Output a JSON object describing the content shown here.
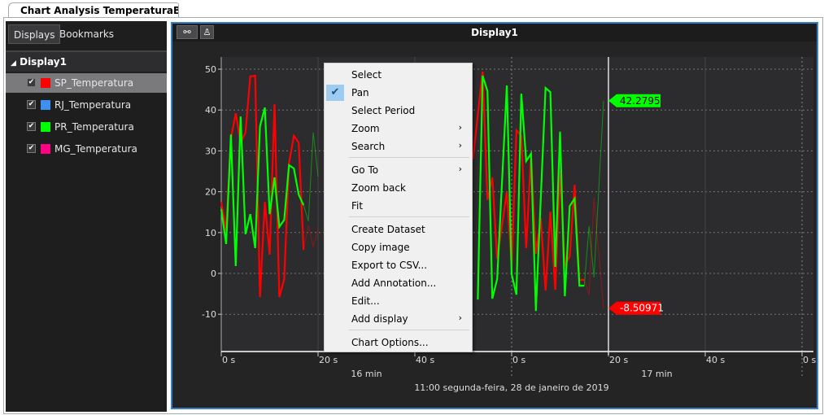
{
  "tab": {
    "title": "Chart Analysis TemperaturaBrasil*"
  },
  "sidebar": {
    "tabs": [
      "Displays",
      "Bookmarks"
    ],
    "group": "Display1",
    "items": [
      {
        "label": "SP_Temperatura",
        "color": "#ff0000",
        "checked": true,
        "selected": true
      },
      {
        "label": "RJ_Temperatura",
        "color": "#3d8ff0",
        "checked": true,
        "selected": false
      },
      {
        "label": "PR_Temperatura",
        "color": "#00ff00",
        "checked": true,
        "selected": false
      },
      {
        "label": "MG_Temperatura",
        "color": "#ff0080",
        "checked": true,
        "selected": false
      }
    ]
  },
  "display": {
    "title": "Display1",
    "toolbar": [
      "link-icon",
      "person-icon"
    ]
  },
  "context_menu": {
    "items": [
      "Select",
      "Pan",
      "Select Period",
      "Zoom",
      "Search",
      "Go To",
      "Zoom back",
      "Fit",
      "Create Dataset",
      "Copy image",
      "Export to CSV...",
      "Add Annotation...",
      "Edit...",
      "Add display",
      "Chart Options..."
    ],
    "checked": "Pan",
    "submenus": [
      "Zoom",
      "Search",
      "Go To",
      "Add display"
    ]
  },
  "chart_data": {
    "type": "line",
    "ylim": [
      -18,
      53
    ],
    "yticks": [
      "50",
      "40",
      "30",
      "20",
      "10",
      "0",
      "-10"
    ],
    "xticks": [
      "0 s",
      "20 s",
      "40 s",
      "0 s",
      "20 s",
      "40 s",
      "0 s"
    ],
    "minute_labels": [
      "16 min",
      "17 min"
    ],
    "date_label": "11:00 segunda-feira, 28 de janeiro de 2019",
    "grid": true,
    "xlim": [
      "11:16:00",
      "11:17:60"
    ],
    "cursor": "11:17:20",
    "cursor_labels": [
      {
        "series": "PR_Temperatura",
        "value": "42.2795",
        "color": "#00ff00"
      },
      {
        "series": "SP_Temperatura",
        "value": "-8.50971",
        "color": "#ff0000"
      }
    ],
    "series": [
      {
        "name": "SP_Temperatura",
        "color": "#ff0000",
        "segments": [
          {
            "x": [
              "11:16:00",
              "11:16:01",
              "11:16:02",
              "11:16:03",
              "11:16:04",
              "11:16:05",
              "11:16:06",
              "11:16:07",
              "11:16:08",
              "11:16:09",
              "11:16:10",
              "11:16:11",
              "11:16:12",
              "11:16:13",
              "11:16:14",
              "11:16:15",
              "11:16:16",
              "11:16:17",
              "11:16:18",
              "11:16:19",
              "11:16:20"
            ],
            "y": [
              17.5,
              10.5,
              33,
              39.2,
              32,
              34.5,
              48.2,
              48.4,
              -5.8,
              17.5,
              4.6,
              41.4,
              -5.8,
              -1.4,
              27,
              33.7,
              32,
              5.8,
              11.7,
              6.6,
              10.7
            ]
          },
          {
            "x": [
              "11:16:52",
              "11:16:54",
              "11:16:55",
              "11:16:56",
              "11:16:57",
              "11:16:59",
              "11:17:00",
              "11:17:01",
              "11:17:02",
              "11:17:03",
              "11:17:04",
              "11:17:05",
              "11:17:06",
              "11:17:07",
              "11:17:08",
              "11:17:09",
              "11:17:10",
              "11:17:11",
              "11:17:12",
              "11:17:13",
              "11:17:14",
              "11:17:15",
              "11:17:16",
              "11:17:17",
              "11:17:19"
            ],
            "y": [
              28,
              49.4,
              18,
              23.5,
              3.6,
              20,
              1.8,
              35,
              33.7,
              6.2,
              29,
              4.8,
              13.5,
              -4.2,
              15.1,
              -4,
              25.1,
              2,
              4.2,
              21.7,
              -1.6,
              -1.6,
              -5.2,
              18.5,
              -8.50971
            ]
          }
        ]
      },
      {
        "name": "PR_Temperatura",
        "color": "#00ff00",
        "segments": [
          {
            "x": [
              "11:16:00",
              "11:16:01",
              "11:16:02",
              "11:16:03",
              "11:16:04",
              "11:16:05",
              "11:16:06",
              "11:16:07",
              "11:16:08",
              "11:16:09",
              "11:16:10",
              "11:16:11",
              "11:16:12",
              "11:16:13",
              "11:16:14",
              "11:16:15",
              "11:16:16",
              "11:16:17",
              "11:16:18",
              "11:16:19",
              "11:16:20"
            ],
            "y": [
              15.7,
              7.2,
              34,
              1.8,
              38.4,
              9.6,
              14.5,
              6.2,
              36,
              40.6,
              14.5,
              23.5,
              11.4,
              13.1,
              26.5,
              25.7,
              19.3,
              16.7,
              12.8,
              34.5,
              23.7
            ]
          },
          {
            "x": [
              "11:16:53",
              "11:16:54",
              "11:16:55",
              "11:16:56",
              "11:16:57",
              "11:16:59",
              "11:17:00",
              "11:17:01",
              "11:17:02",
              "11:17:03",
              "11:17:04",
              "11:17:05",
              "11:17:07",
              "11:17:08",
              "11:17:09",
              "11:17:10",
              "11:17:11",
              "11:17:12",
              "11:17:13",
              "11:17:14",
              "11:17:15",
              "11:17:16",
              "11:17:17",
              "11:17:19"
            ],
            "y": [
              -6.4,
              48.4,
              44.6,
              -6.2,
              -1.4,
              46,
              -0.2,
              -5.2,
              44,
              27.5,
              29.3,
              -9.2,
              45.4,
              44.4,
              1.6,
              34.7,
              -5.6,
              16.5,
              18.3,
              -3,
              -3,
              11.6,
              -1,
              42.2795
            ]
          }
        ]
      }
    ]
  }
}
